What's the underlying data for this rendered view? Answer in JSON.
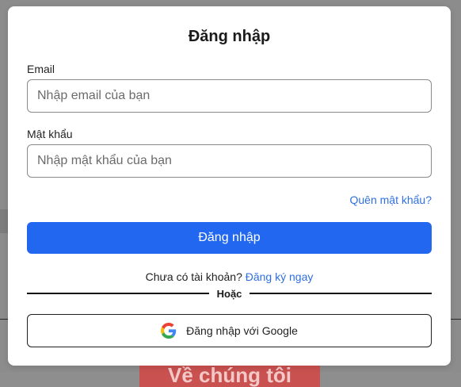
{
  "background": {
    "banner_text": "Về chúng tôi"
  },
  "modal": {
    "title": "Đăng nhập",
    "email": {
      "label": "Email",
      "placeholder": "Nhập email của bạn",
      "value": ""
    },
    "password": {
      "label": "Mật khẩu",
      "placeholder": "Nhập mật khẩu của bạn",
      "value": ""
    },
    "forgot_password": "Quên mật khẩu?",
    "login_button": "Đăng nhập",
    "signup_prompt": "Chưa có tài khoản?",
    "signup_link": "Đăng ký ngay",
    "divider_text": "Hoặc",
    "google_button": "Đăng nhập với Google",
    "google_icon": "google-logo-icon"
  },
  "colors": {
    "accent": "#2167f0",
    "link": "#2f6fe0",
    "overlay": "#8c8c8c"
  }
}
